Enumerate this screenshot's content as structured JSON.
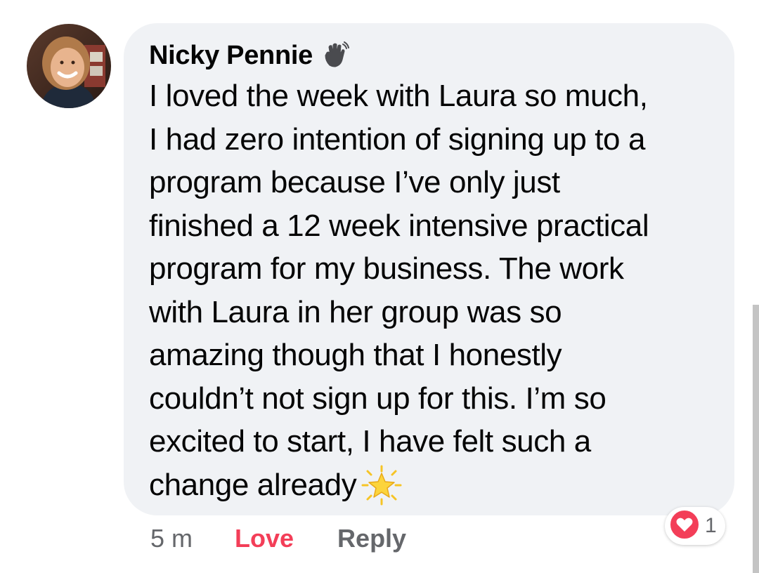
{
  "comment": {
    "author": "Nicky Pennie",
    "author_badge_icon": "waving-hand-icon",
    "text_lines": [
      "I loved the week with Laura so much,",
      "I had zero intention of signing up to a",
      "program because I’ve only just",
      "finished a 12 week intensive practical",
      "program for my business. The work",
      "with Laura in her group was so",
      "amazing though that I honestly",
      "couldn’t not sign up for this. I’m so",
      "excited to start, I have felt such a",
      "change already"
    ],
    "trailing_emoji_icon": "glowing-star-icon",
    "timestamp": "5 m",
    "reacted_label": "Love",
    "reply_label": "Reply",
    "reaction": {
      "icon": "heart-icon",
      "count": "1"
    }
  },
  "colors": {
    "bubble_bg": "#f0f2f5",
    "love_red": "#f33e58",
    "secondary_text": "#65676b",
    "primary_text": "#050505"
  }
}
